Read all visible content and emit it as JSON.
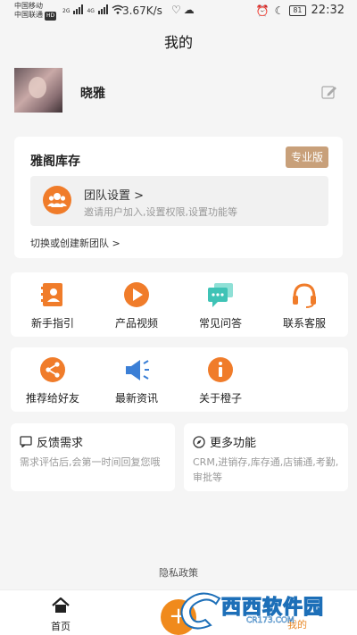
{
  "status_bar": {
    "carrier_1": "中国移动",
    "carrier_2": "中国联通",
    "hd_badge": "HD",
    "sig1_label": "2G",
    "sig2_label": "4G",
    "net_speed": "3.67K/s",
    "battery": "81",
    "time": "22:32",
    "icons": [
      "signal-icon",
      "wifi-icon",
      "heartbeat-icon",
      "wechat-icon",
      "alarm-icon",
      "moon-icon",
      "battery-icon"
    ]
  },
  "header": {
    "title": "我的"
  },
  "profile": {
    "username": "晓雅"
  },
  "team": {
    "name": "雅阁库存",
    "edition": "专业版",
    "setting_title": "团队设置 >",
    "setting_desc": "邀请用户加入,设置权限,设置功能等",
    "switch_label": "切换或创建新团队 >"
  },
  "grid1": [
    {
      "label": "新手指引",
      "icon": "guide-book-icon"
    },
    {
      "label": "产品视频",
      "icon": "play-video-icon"
    },
    {
      "label": "常见问答",
      "icon": "chat-bubbles-icon"
    },
    {
      "label": "联系客服",
      "icon": "headset-icon"
    }
  ],
  "grid2": [
    {
      "label": "推荐给好友",
      "icon": "share-icon"
    },
    {
      "label": "最新资讯",
      "icon": "megaphone-icon"
    },
    {
      "label": "关于橙子",
      "icon": "info-icon"
    }
  ],
  "feedback": {
    "title": "反馈需求",
    "desc": "需求评估后,会第一时间回复您哦"
  },
  "more": {
    "title": "更多功能",
    "desc": "CRM,进销存,库存通,店铺通,考勤,审批等"
  },
  "footer": {
    "privacy": "隐私政策"
  },
  "tab_bar": {
    "home_label": "首页",
    "add_label": "+",
    "mine_label": "我的"
  },
  "watermark": {
    "text": "西西软件园",
    "sub": "CR173.COM"
  },
  "colors": {
    "accent": "#f07c2a",
    "edition_badge": "#c8a07a",
    "chat_icon": "#3fc3b6",
    "megaphone_icon": "#3b7fd6"
  }
}
